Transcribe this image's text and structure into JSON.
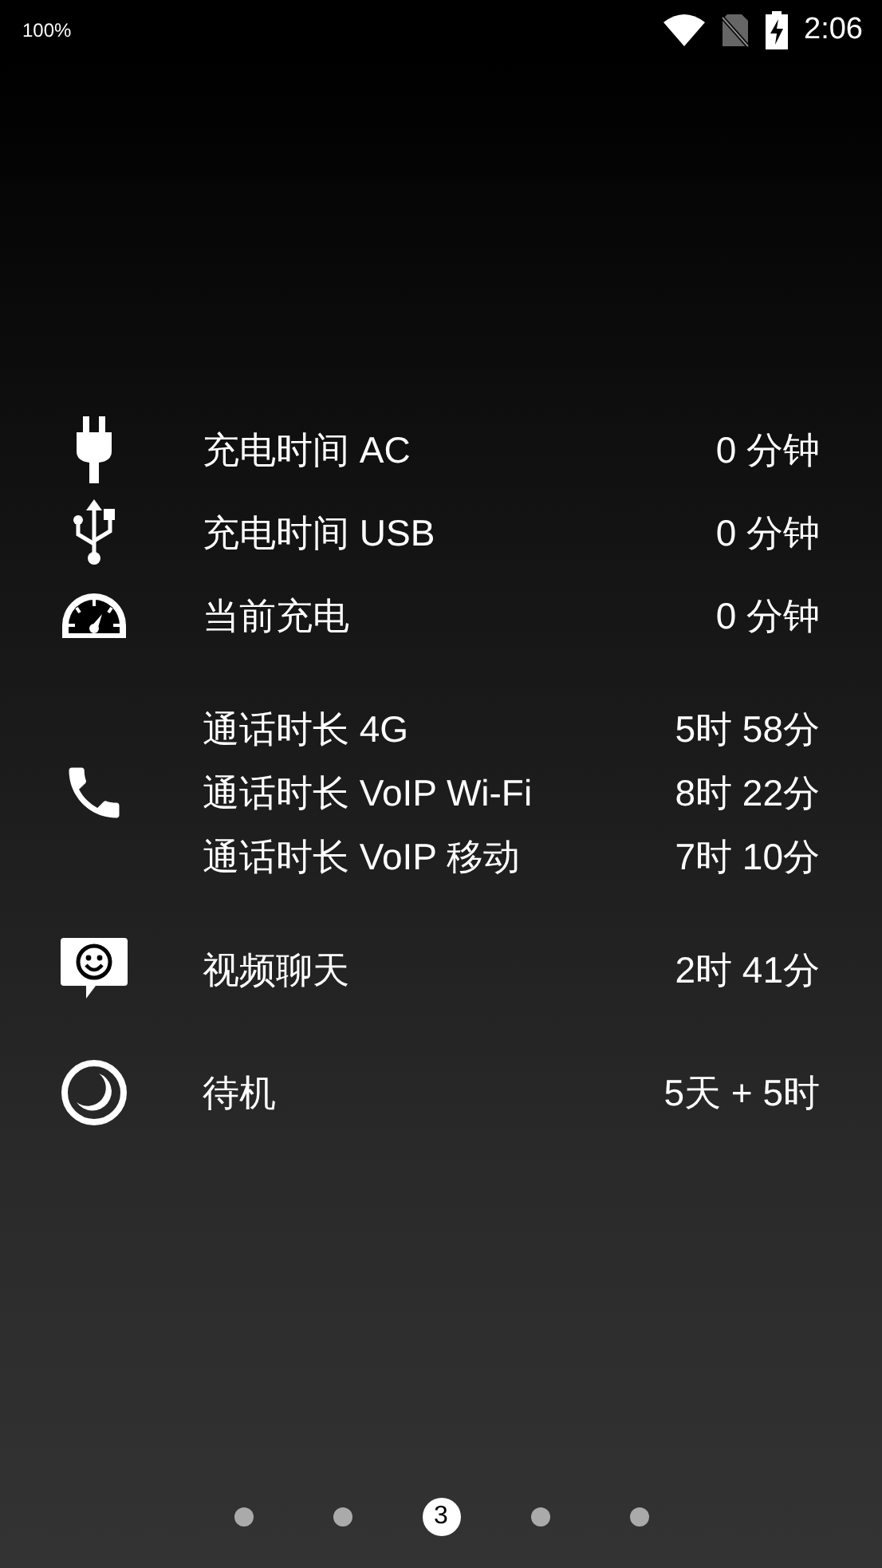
{
  "status_bar": {
    "battery_text": "100%",
    "time": "2:06"
  },
  "groups": [
    {
      "kind": "plug",
      "rows": [
        {
          "label": "充电时间 AC",
          "value": "0 分钟"
        }
      ]
    },
    {
      "kind": "usb",
      "rows": [
        {
          "label": "充电时间 USB",
          "value": "0 分钟"
        }
      ]
    },
    {
      "kind": "gauge",
      "rows": [
        {
          "label": "当前充电",
          "value": "0 分钟"
        }
      ]
    },
    {
      "kind": "phone",
      "rows": [
        {
          "label": "通话时长 4G",
          "value": "5时 58分"
        },
        {
          "label": "通话时长 VoIP Wi-Fi",
          "value": "8时 22分"
        },
        {
          "label": "通话时长 VoIP 移动",
          "value": "7时 10分"
        }
      ]
    },
    {
      "kind": "chat",
      "rows": [
        {
          "label": "视频聊天",
          "value": "2时 41分"
        }
      ]
    },
    {
      "kind": "moon",
      "rows": [
        {
          "label": "待机",
          "value": "5天 + 5时"
        }
      ]
    }
  ],
  "pages": [
    {
      "selected": false
    },
    {
      "selected": false
    },
    {
      "selected": true,
      "label": "3"
    },
    {
      "selected": false
    },
    {
      "selected": false
    }
  ]
}
